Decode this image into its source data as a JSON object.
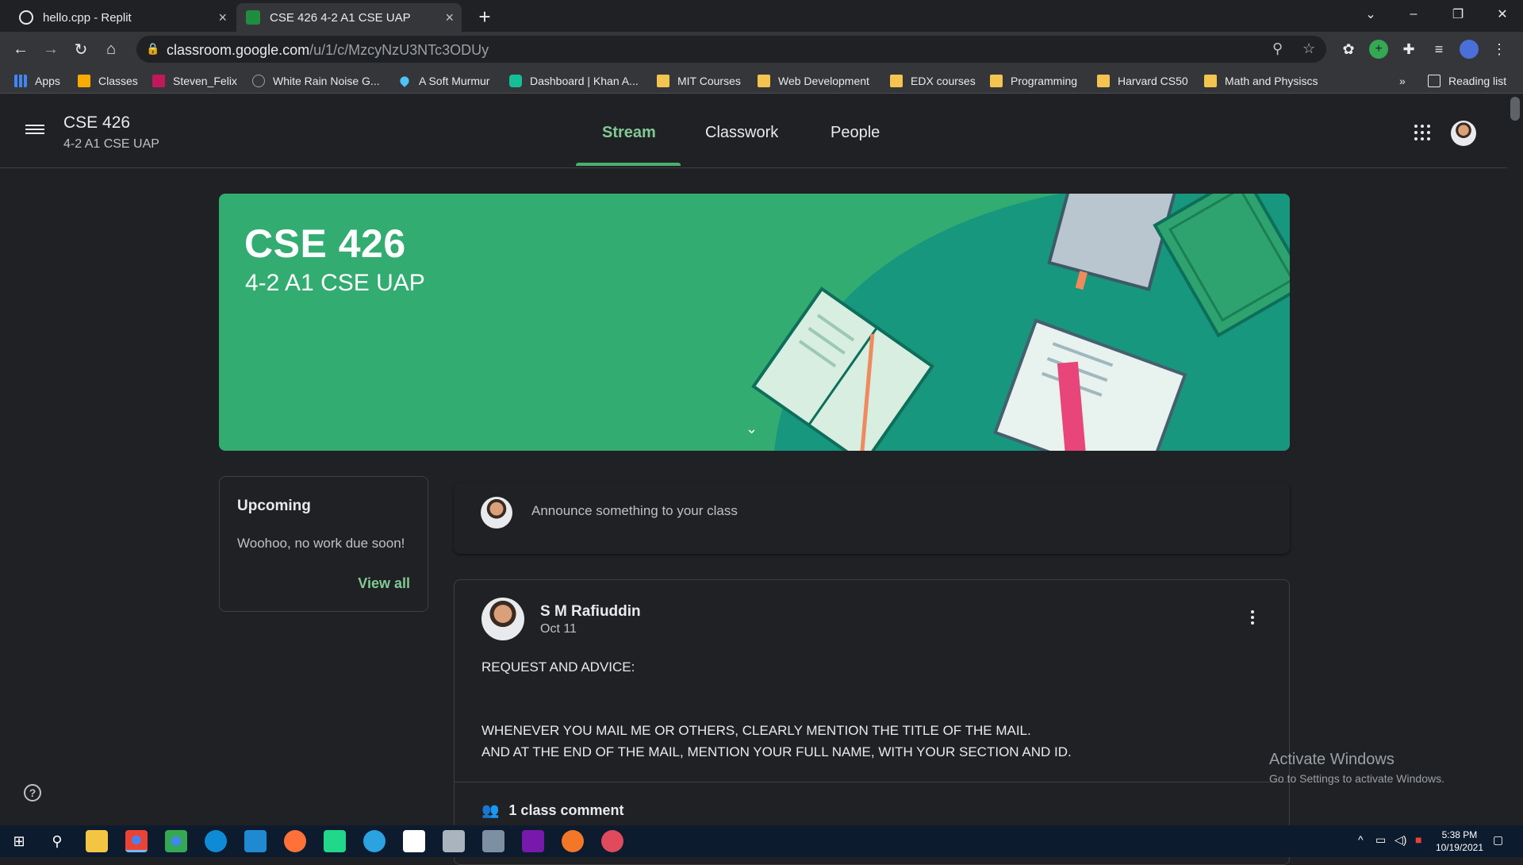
{
  "browser": {
    "tabs": [
      {
        "title": "hello.cpp - Replit"
      },
      {
        "title": "CSE 426 4-2 A1 CSE UAP"
      }
    ],
    "url_host": "classroom.google.com",
    "url_path": "/u/1/c/MzcyNzU3NTc3ODUy",
    "bookmarks": [
      "Apps",
      "Classes",
      "Steven_Felix",
      "White Rain Noise G...",
      "A Soft Murmur",
      "Dashboard | Khan A...",
      "MIT Courses",
      "Web Development",
      "EDX courses",
      "Programming",
      "Harvard CS50",
      "Math and Physiscs"
    ],
    "bookmarks_overflow": "»",
    "reading_list": "Reading list"
  },
  "classroom": {
    "class_name": "CSE 426",
    "class_section": "4-2 A1 CSE UAP",
    "nav_tabs": [
      "Stream",
      "Classwork",
      "People"
    ],
    "banner_title": "CSE 426",
    "banner_subtitle": "4-2 A1 CSE UAP",
    "upcoming": {
      "heading": "Upcoming",
      "text": "Woohoo, no work due soon!",
      "link": "View all"
    },
    "announce_placeholder": "Announce something to your class",
    "post": {
      "author": "S M Rafiuddin",
      "date": "Oct 11",
      "lines": [
        "REQUEST AND ADVICE:",
        "WHENEVER YOU MAIL ME OR OTHERS, CLEARLY MENTION THE TITLE OF THE MAIL.",
        "AND AT THE END OF THE MAIL, MENTION YOUR FULL NAME, WITH YOUR SECTION AND ID."
      ],
      "comments": "1 class comment"
    }
  },
  "watermark": {
    "line1": "Activate Windows",
    "line2": "Go to Settings to activate Windows."
  },
  "taskbar": {
    "time": "5:38 PM",
    "date": "10/19/2021"
  },
  "colors": {
    "accent": "#81c995",
    "banner": "#33ac71",
    "background": "#202124"
  }
}
